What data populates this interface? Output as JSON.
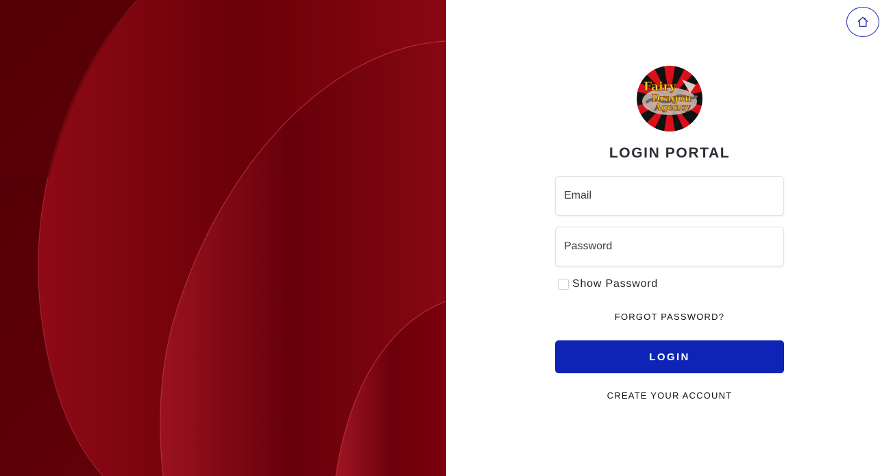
{
  "hero": {
    "background_icon": "abstract-red-curves",
    "colors": {
      "dark": "#5e0007",
      "mid": "#7d000d",
      "light": "#9a0f1c"
    }
  },
  "header": {
    "home_icon": "home-icon",
    "accent_color": "#1a2cb0"
  },
  "logo": {
    "icon": "fairy-dragon-agency-logo",
    "text": "Fairy Dragon Agency"
  },
  "login": {
    "title": "LOGIN PORTAL",
    "email_placeholder": "Email",
    "email_value": "",
    "password_placeholder": "Password",
    "password_value": "",
    "show_password_label": "Show Password",
    "show_password_checked": false,
    "forgot_label": "FORGOT PASSWORD?",
    "submit_label": "LOGIN",
    "create_label": "CREATE YOUR ACCOUNT",
    "primary_color": "#0d24b6"
  }
}
